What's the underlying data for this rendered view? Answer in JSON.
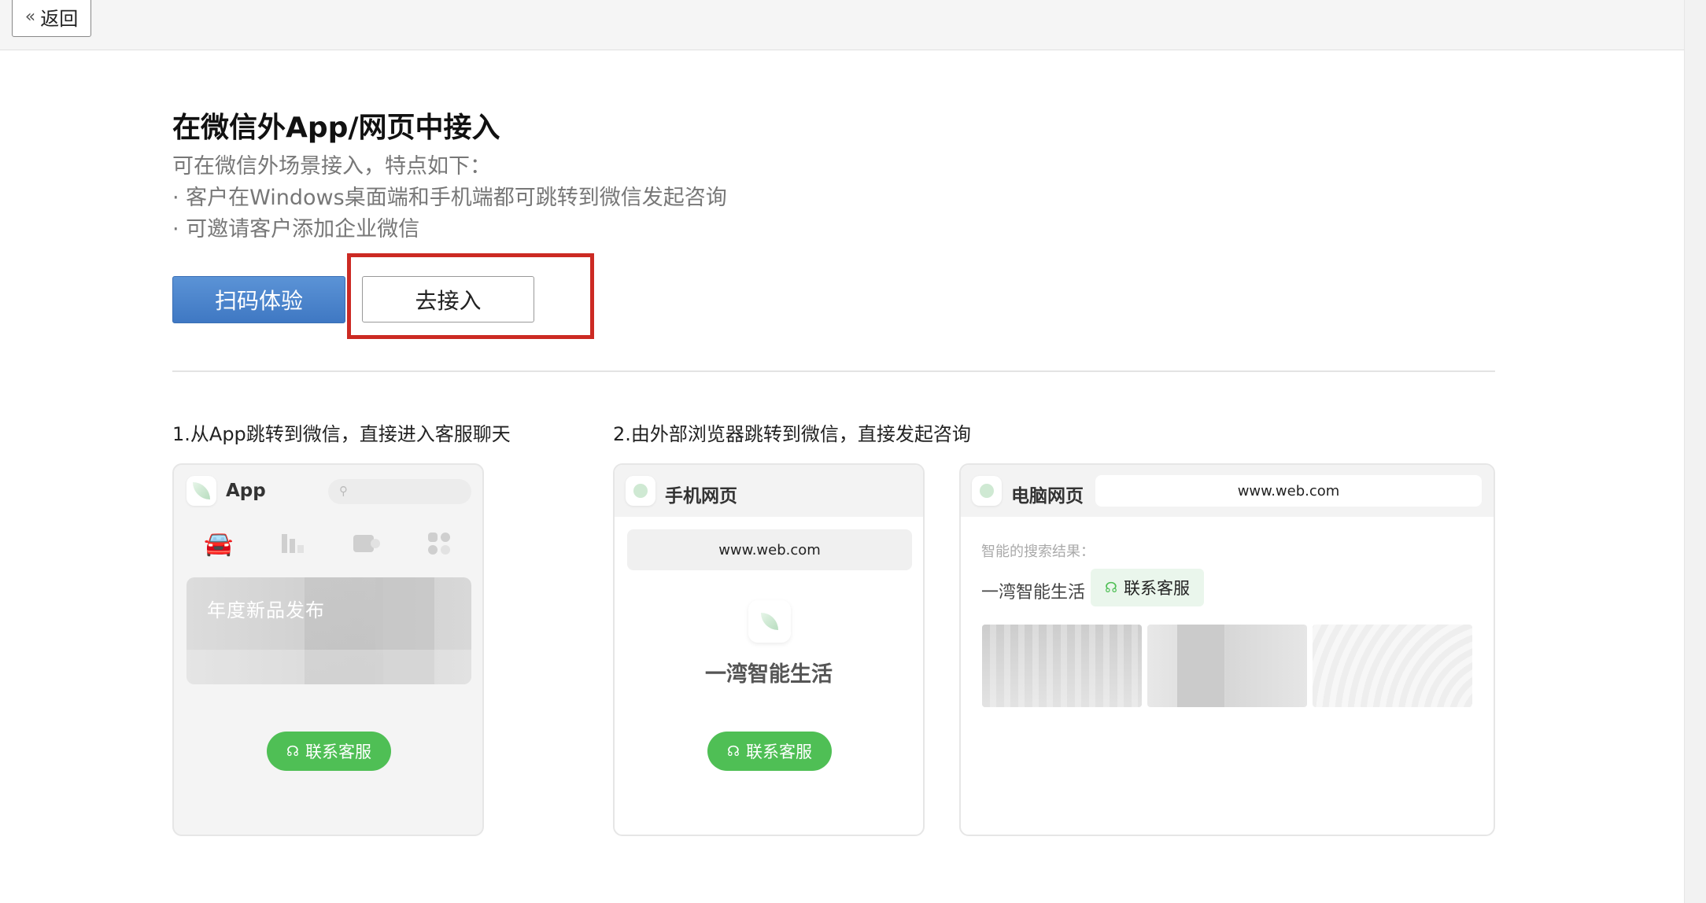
{
  "topbar": {
    "back_label": "返回",
    "back_icon": "double-chevron-left-icon"
  },
  "header": {
    "title": "在微信外App/网页中接入",
    "intro": "可在微信外场景接入，特点如下：",
    "bullets": [
      "· 客户在Windows桌面端和手机端都可跳转到微信发起咨询",
      "· 可邀请客户添加企业微信"
    ]
  },
  "actions": {
    "scan_label": "扫码体验",
    "connect_label": "去接入",
    "highlight_color": "#cc2a23",
    "primary_color": "#4a85cd"
  },
  "sections": [
    {
      "label": "1.从App跳转到微信，直接进入客服聊天"
    },
    {
      "label": "2.由外部浏览器跳转到微信，直接发起咨询"
    }
  ],
  "app_card": {
    "title": "App",
    "icons": [
      "car-icon",
      "bar-chart-icon",
      "video-icon",
      "apps-icon"
    ],
    "banner_text": "年度新品发布",
    "contact_label": "联系客服"
  },
  "mobile_card": {
    "title": "手机网页",
    "url": "www.web.com",
    "brand": "一湾智能生活",
    "contact_label": "联系客服"
  },
  "pc_card": {
    "title": "电脑网页",
    "url": "www.web.com",
    "search_hint": "智能的搜索结果：",
    "result_name": "一湾智能生活",
    "contact_label": "联系客服"
  },
  "accent_green": "#4fbf55"
}
